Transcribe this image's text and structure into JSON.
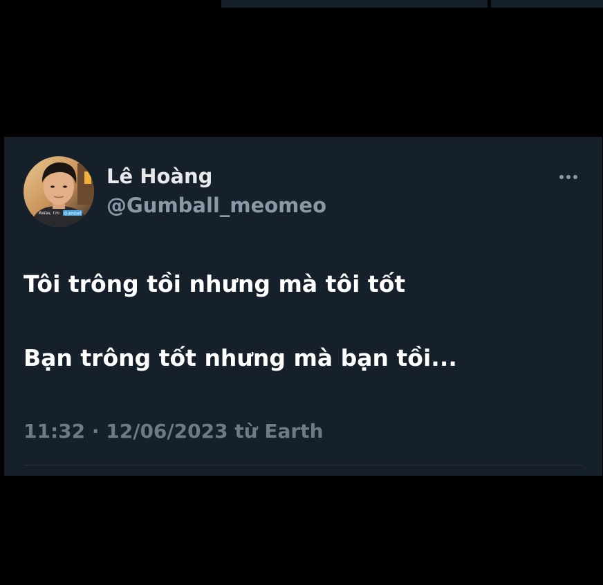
{
  "tweet": {
    "author": {
      "display_name": "Lê Hoàng",
      "handle": "@Gumball_meomeo",
      "avatar_caption": "Relax, I'm Gumball"
    },
    "lines": [
      "Tôi trông tồi nhưng mà tôi tốt",
      "Bạn trông tốt nhưng mà bạn tồi..."
    ],
    "timestamp": "11:32 · 12/06/2023 từ Earth",
    "more_icon": "more-horizontal-icon"
  },
  "colors": {
    "background": "#000000",
    "card": "#15202b",
    "primary_text": "#ffffff",
    "secondary_text": "#8b98a5"
  }
}
